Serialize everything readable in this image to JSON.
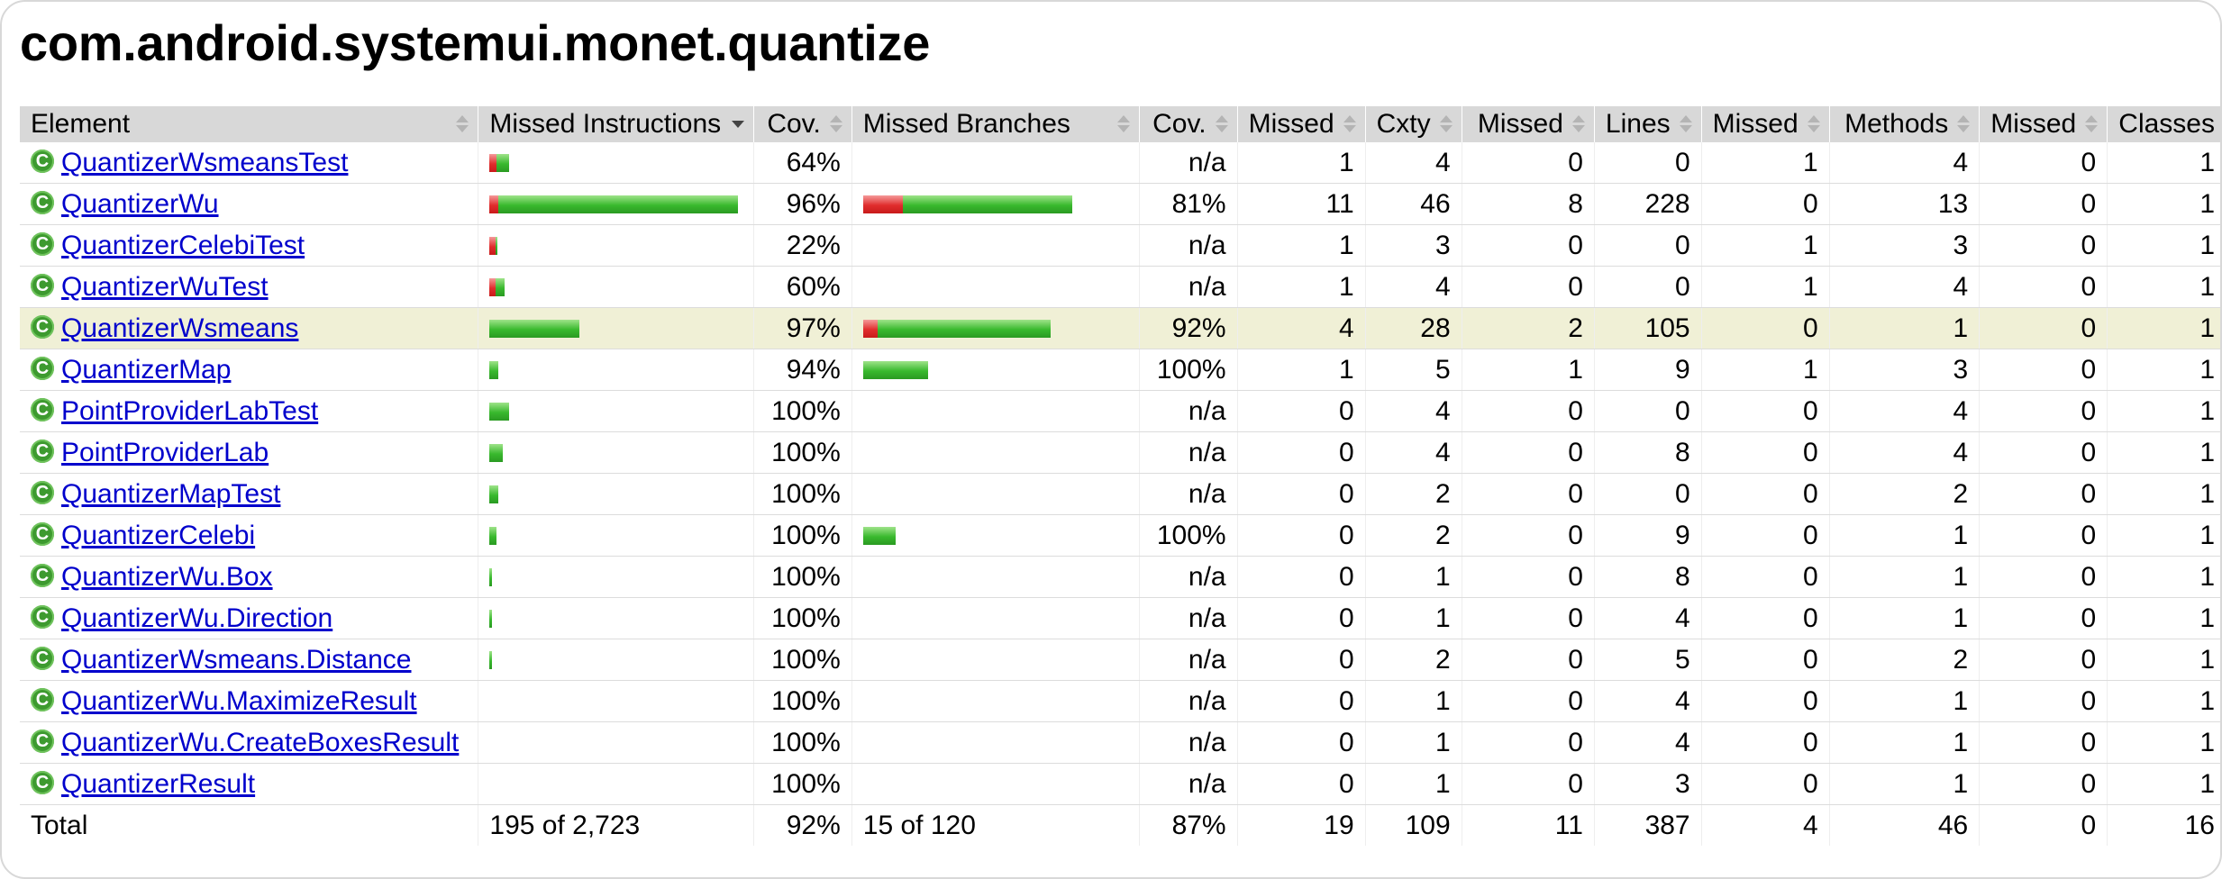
{
  "title": "com.android.systemui.monet.quantize",
  "columns": {
    "element": "Element",
    "missed_instructions": "Missed Instructions",
    "cov1": "Cov.",
    "missed_branches": "Missed Branches",
    "cov2": "Cov.",
    "missed_cxty": "Missed",
    "cxty": "Cxty",
    "missed_lines": "Missed",
    "lines": "Lines",
    "missed_methods": "Missed",
    "methods": "Methods",
    "missed_classes": "Missed",
    "classes": "Classes"
  },
  "class_icon_letter": "C",
  "rows": [
    {
      "name": "QuantizerWsmeansTest",
      "instr_bar": {
        "red_units": 8,
        "green_units": 14
      },
      "cov1": "64%",
      "branch_bar": null,
      "cov2": "n/a",
      "mcx": "1",
      "cx": "4",
      "ml": "0",
      "l": "0",
      "mm": "1",
      "m": "4",
      "mc": "0",
      "c": "1"
    },
    {
      "name": "QuantizerWu",
      "instr_bar": {
        "red_units": 10,
        "green_units": 266
      },
      "cov1": "96%",
      "branch_bar": {
        "red_units": 11,
        "green_units": 47
      },
      "cov2": "81%",
      "mcx": "11",
      "cx": "46",
      "ml": "8",
      "l": "228",
      "mm": "0",
      "m": "13",
      "mc": "0",
      "c": "1"
    },
    {
      "name": "QuantizerCelebiTest",
      "instr_bar": {
        "red_units": 7,
        "green_units": 2
      },
      "cov1": "22%",
      "branch_bar": null,
      "cov2": "n/a",
      "mcx": "1",
      "cx": "3",
      "ml": "0",
      "l": "0",
      "mm": "1",
      "m": "3",
      "mc": "0",
      "c": "1"
    },
    {
      "name": "QuantizerWuTest",
      "instr_bar": {
        "red_units": 7,
        "green_units": 10
      },
      "cov1": "60%",
      "branch_bar": null,
      "cov2": "n/a",
      "mcx": "1",
      "cx": "4",
      "ml": "0",
      "l": "0",
      "mm": "1",
      "m": "4",
      "mc": "0",
      "c": "1"
    },
    {
      "name": "QuantizerWsmeans",
      "instr_bar": {
        "red_units": 0,
        "green_units": 100
      },
      "cov1": "97%",
      "branch_bar": {
        "red_units": 4,
        "green_units": 48
      },
      "cov2": "92%",
      "mcx": "4",
      "cx": "28",
      "ml": "2",
      "l": "105",
      "mm": "0",
      "m": "1",
      "mc": "0",
      "c": "1",
      "highlight": true
    },
    {
      "name": "QuantizerMap",
      "instr_bar": {
        "red_units": 0,
        "green_units": 10
      },
      "cov1": "94%",
      "branch_bar": {
        "red_units": 0,
        "green_units": 18
      },
      "cov2": "100%",
      "mcx": "1",
      "cx": "5",
      "ml": "1",
      "l": "9",
      "mm": "1",
      "m": "3",
      "mc": "0",
      "c": "1"
    },
    {
      "name": "PointProviderLabTest",
      "instr_bar": {
        "red_units": 0,
        "green_units": 22
      },
      "cov1": "100%",
      "branch_bar": null,
      "cov2": "n/a",
      "mcx": "0",
      "cx": "4",
      "ml": "0",
      "l": "0",
      "mm": "0",
      "m": "4",
      "mc": "0",
      "c": "1"
    },
    {
      "name": "PointProviderLab",
      "instr_bar": {
        "red_units": 0,
        "green_units": 15
      },
      "cov1": "100%",
      "branch_bar": null,
      "cov2": "n/a",
      "mcx": "0",
      "cx": "4",
      "ml": "0",
      "l": "8",
      "mm": "0",
      "m": "4",
      "mc": "0",
      "c": "1"
    },
    {
      "name": "QuantizerMapTest",
      "instr_bar": {
        "red_units": 0,
        "green_units": 10
      },
      "cov1": "100%",
      "branch_bar": null,
      "cov2": "n/a",
      "mcx": "0",
      "cx": "2",
      "ml": "0",
      "l": "0",
      "mm": "0",
      "m": "2",
      "mc": "0",
      "c": "1"
    },
    {
      "name": "QuantizerCelebi",
      "instr_bar": {
        "red_units": 0,
        "green_units": 8
      },
      "cov1": "100%",
      "branch_bar": {
        "red_units": 0,
        "green_units": 9
      },
      "cov2": "100%",
      "mcx": "0",
      "cx": "2",
      "ml": "0",
      "l": "9",
      "mm": "0",
      "m": "1",
      "mc": "0",
      "c": "1"
    },
    {
      "name": "QuantizerWu.Box",
      "instr_bar": {
        "red_units": 0,
        "green_units": 3
      },
      "cov1": "100%",
      "branch_bar": null,
      "cov2": "n/a",
      "mcx": "0",
      "cx": "1",
      "ml": "0",
      "l": "8",
      "mm": "0",
      "m": "1",
      "mc": "0",
      "c": "1"
    },
    {
      "name": "QuantizerWu.Direction",
      "instr_bar": {
        "red_units": 0,
        "green_units": 3
      },
      "cov1": "100%",
      "branch_bar": null,
      "cov2": "n/a",
      "mcx": "0",
      "cx": "1",
      "ml": "0",
      "l": "4",
      "mm": "0",
      "m": "1",
      "mc": "0",
      "c": "1"
    },
    {
      "name": "QuantizerWsmeans.Distance",
      "instr_bar": {
        "red_units": 0,
        "green_units": 3
      },
      "cov1": "100%",
      "branch_bar": null,
      "cov2": "n/a",
      "mcx": "0",
      "cx": "2",
      "ml": "0",
      "l": "5",
      "mm": "0",
      "m": "2",
      "mc": "0",
      "c": "1"
    },
    {
      "name": "QuantizerWu.MaximizeResult",
      "instr_bar": null,
      "cov1": "100%",
      "branch_bar": null,
      "cov2": "n/a",
      "mcx": "0",
      "cx": "1",
      "ml": "0",
      "l": "4",
      "mm": "0",
      "m": "1",
      "mc": "0",
      "c": "1"
    },
    {
      "name": "QuantizerWu.CreateBoxesResult",
      "instr_bar": null,
      "cov1": "100%",
      "branch_bar": null,
      "cov2": "n/a",
      "mcx": "0",
      "cx": "1",
      "ml": "0",
      "l": "4",
      "mm": "0",
      "m": "1",
      "mc": "0",
      "c": "1"
    },
    {
      "name": "QuantizerResult",
      "instr_bar": null,
      "cov1": "100%",
      "branch_bar": null,
      "cov2": "n/a",
      "mcx": "0",
      "cx": "1",
      "ml": "0",
      "l": "3",
      "mm": "0",
      "m": "1",
      "mc": "0",
      "c": "1"
    }
  ],
  "total": {
    "label": "Total",
    "missed_instructions": "195 of 2,723",
    "cov1": "92%",
    "missed_branches": "15 of 120",
    "cov2": "87%",
    "mcx": "19",
    "cx": "109",
    "ml": "11",
    "l": "387",
    "mm": "4",
    "m": "46",
    "mc": "0",
    "c": "16"
  },
  "colors": {
    "header_bg": "#d8d8d8",
    "highlight_bg": "#f0f0d6",
    "bar_missed": "#e02d2d",
    "bar_covered": "#39b92e",
    "link": "#0000cc",
    "class_icon": "#3d9a2f"
  }
}
